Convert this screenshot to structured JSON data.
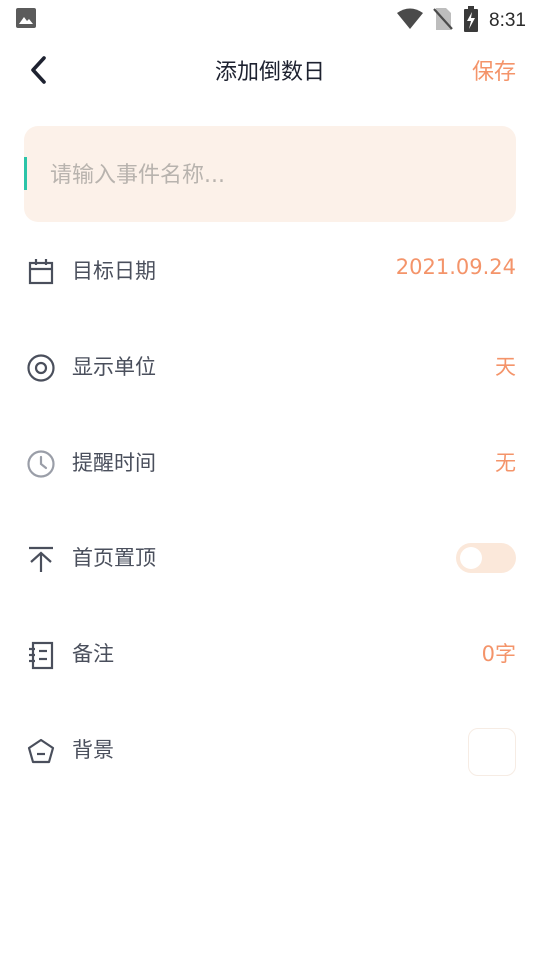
{
  "status_bar": {
    "time": "8:31",
    "icons": [
      "gallery-icon",
      "wifi-icon",
      "no-sim-icon",
      "battery-charging-icon"
    ]
  },
  "header": {
    "back_icon": "chevron-left-icon",
    "title": "添加倒数日",
    "save_label": "保存"
  },
  "event_input": {
    "placeholder": "请输入事件名称...",
    "value": ""
  },
  "settings": {
    "target_date": {
      "icon": "calendar-icon",
      "label": "目标日期",
      "value": "2021.09.24"
    },
    "display_unit": {
      "icon": "eye-icon",
      "label": "显示单位",
      "value": "天"
    },
    "reminder_time": {
      "icon": "clock-icon",
      "label": "提醒时间",
      "value": "无"
    },
    "pin_top": {
      "icon": "pin-top-icon",
      "label": "首页置顶",
      "enabled": false
    },
    "note": {
      "icon": "notebook-icon",
      "label": "备注",
      "value": "0字"
    },
    "background": {
      "icon": "pentagon-icon",
      "label": "背景"
    }
  },
  "colors": {
    "accent": "#f4946a",
    "input_background": "#fcf1e9",
    "caret": "#2cc4a8",
    "toggle_track": "#fbe8da"
  }
}
